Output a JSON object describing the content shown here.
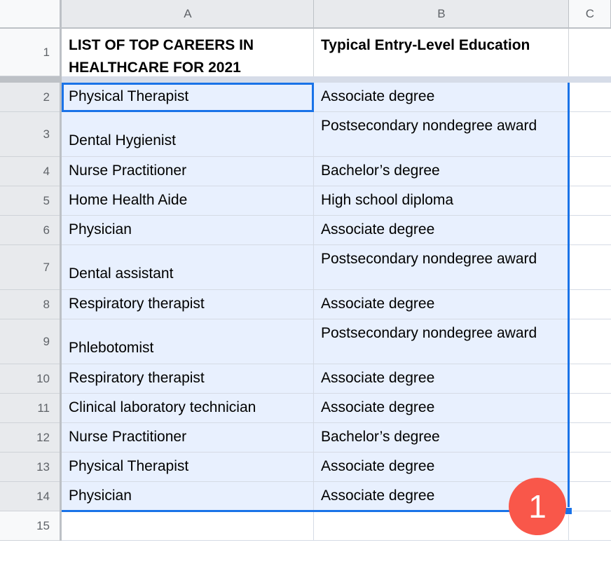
{
  "app": {
    "type": "spreadsheet",
    "accent_color": "#1a73e8",
    "selection_fill": "#e8f0fe",
    "badge_color": "#f9574a"
  },
  "columns": [
    {
      "label": "A",
      "selected": true
    },
    {
      "label": "B",
      "selected": true
    },
    {
      "label": "C",
      "selected": false
    }
  ],
  "rows": [
    {
      "number": "1",
      "selected": false,
      "tall": false,
      "header": true,
      "a": "LIST OF TOP CAREERS IN HEALTHCARE FOR 2021",
      "b": "Typical Entry-Level Education"
    },
    {
      "number": "2",
      "selected": true,
      "tall": false,
      "header": false,
      "a": "Physical Therapist",
      "b": "Associate degree"
    },
    {
      "number": "3",
      "selected": true,
      "tall": true,
      "header": false,
      "a": "Dental Hygienist",
      "b": "Postsecondary nondegree award"
    },
    {
      "number": "4",
      "selected": true,
      "tall": false,
      "header": false,
      "a": "Nurse Practitioner",
      "b": "Bachelor’s degree"
    },
    {
      "number": "5",
      "selected": true,
      "tall": false,
      "header": false,
      "a": "Home Health Aide",
      "b": "High school diploma"
    },
    {
      "number": "6",
      "selected": true,
      "tall": false,
      "header": false,
      "a": "Physician",
      "b": "Associate degree"
    },
    {
      "number": "7",
      "selected": true,
      "tall": true,
      "header": false,
      "a": "Dental assistant",
      "b": "Postsecondary nondegree award"
    },
    {
      "number": "8",
      "selected": true,
      "tall": false,
      "header": false,
      "a": "Respiratory therapist",
      "b": "Associate degree"
    },
    {
      "number": "9",
      "selected": true,
      "tall": true,
      "header": false,
      "a": "Phlebotomist",
      "b": "Postsecondary nondegree award"
    },
    {
      "number": "10",
      "selected": true,
      "tall": false,
      "header": false,
      "a": "Respiratory therapist",
      "b": "Associate degree"
    },
    {
      "number": "11",
      "selected": true,
      "tall": false,
      "header": false,
      "a": "Clinical laboratory technician",
      "b": "Associate degree"
    },
    {
      "number": "12",
      "selected": true,
      "tall": false,
      "header": false,
      "a": "Nurse Practitioner",
      "b": "Bachelor’s degree"
    },
    {
      "number": "13",
      "selected": true,
      "tall": false,
      "header": false,
      "a": "Physical Therapist",
      "b": "Associate degree"
    },
    {
      "number": "14",
      "selected": true,
      "tall": false,
      "header": false,
      "a": "Physician",
      "b": "Associate degree"
    },
    {
      "number": "15",
      "selected": false,
      "tall": false,
      "header": false,
      "a": "",
      "b": ""
    }
  ],
  "active_cell": "A2",
  "annotation": {
    "label": "1"
  }
}
